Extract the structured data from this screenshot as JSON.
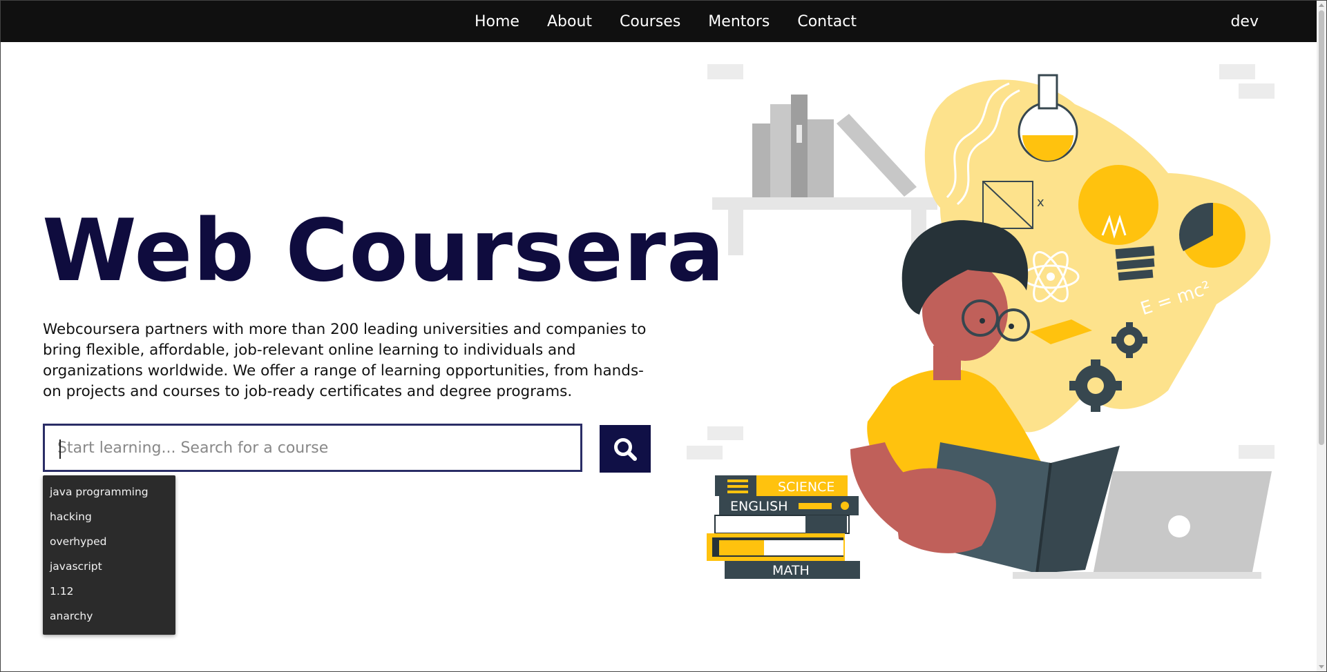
{
  "nav": {
    "links": [
      "Home",
      "About",
      "Courses",
      "Mentors",
      "Contact"
    ],
    "user": "dev"
  },
  "hero": {
    "title": "Web Coursera",
    "description": "Webcoursera partners with more than 200 leading universities and companies to bring flexible, affordable, job-relevant online learning to individuals and organizations worldwide. We offer a range of learning opportunities, from hands-on projects and courses to job-ready certificates and degree programs."
  },
  "search": {
    "placeholder": "Start learning... Search for a course",
    "value": "",
    "button_icon": "search-icon",
    "suggestions": [
      "java programming",
      "hacking",
      "overhyped",
      "javascript",
      "1.12",
      "anarchy"
    ]
  },
  "illustration": {
    "books": [
      "SCIENCE",
      "ENGLISH",
      "MATH"
    ],
    "formula": "E = mc²"
  },
  "colors": {
    "navbar": "#101010",
    "title": "#0f0c3e",
    "search_border": "#2a2d66",
    "search_button": "#101046",
    "dropdown": "#2b2b2b",
    "accent_yellow": "#ffc20e",
    "accent_light_yellow": "#fde28c",
    "teal": "#37474f",
    "skin": "#c0605a"
  }
}
